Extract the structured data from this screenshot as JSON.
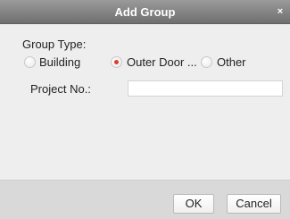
{
  "dialog": {
    "title": "Add Group",
    "close_glyph": "×"
  },
  "form": {
    "group_type_label": "Group Type:",
    "options": [
      {
        "label": "Building",
        "checked": false
      },
      {
        "label": "Outer Door ...",
        "checked": true
      },
      {
        "label": "Other",
        "checked": false
      }
    ],
    "project_no_label": "Project No.:",
    "project_no_value": "",
    "project_no_placeholder": ""
  },
  "footer": {
    "ok_label": "OK",
    "cancel_label": "Cancel"
  },
  "colors": {
    "titlebar": "#7d7d7d",
    "radio_selected": "#e23a2e",
    "body_bg": "#eeeeee",
    "footer_bg": "#d9d9d9"
  },
  "icons": {
    "close": "close-icon"
  }
}
